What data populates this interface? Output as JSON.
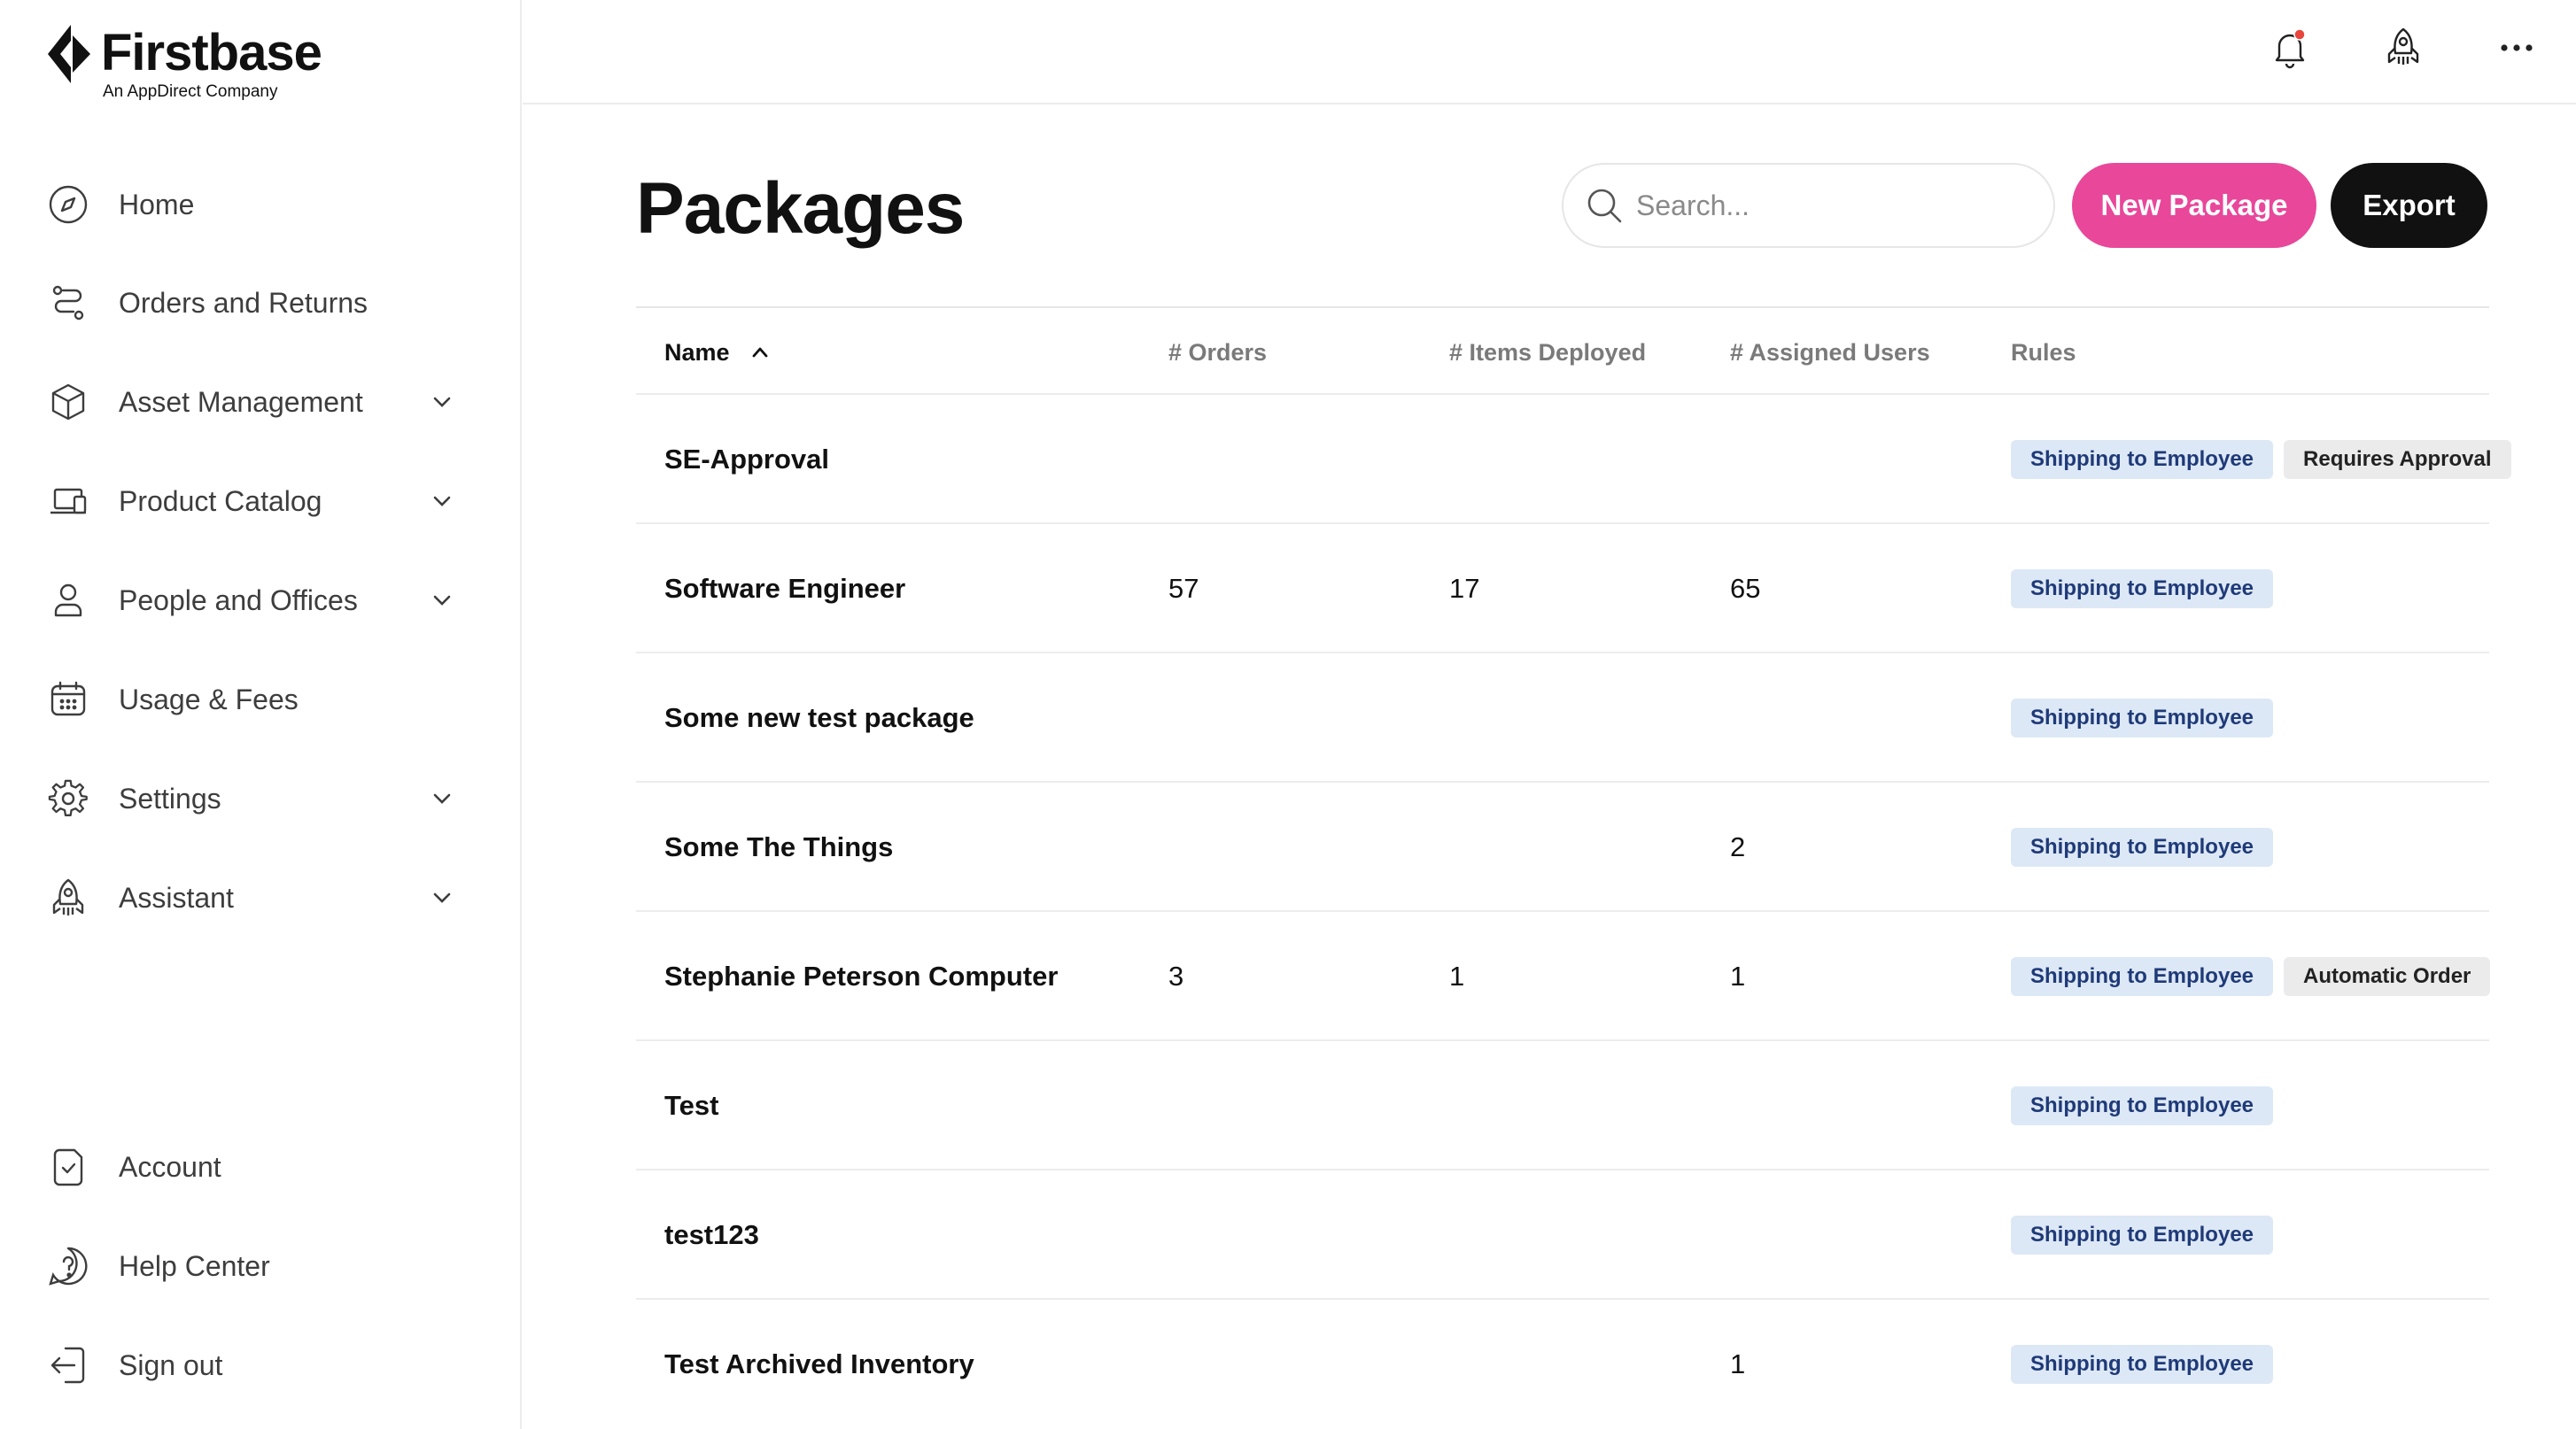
{
  "brand": {
    "name": "Firstbase",
    "tagline": "An AppDirect Company"
  },
  "sidebar": {
    "items": [
      {
        "label": "Home",
        "icon": "compass-icon",
        "expandable": false
      },
      {
        "label": "Orders and Returns",
        "icon": "route-icon",
        "expandable": false
      },
      {
        "label": "Asset Management",
        "icon": "box-icon",
        "expandable": true
      },
      {
        "label": "Product Catalog",
        "icon": "laptop-icon",
        "expandable": true
      },
      {
        "label": "People and Offices",
        "icon": "person-icon",
        "expandable": true
      },
      {
        "label": "Usage & Fees",
        "icon": "calendar-icon",
        "expandable": false
      },
      {
        "label": "Settings",
        "icon": "gear-icon",
        "expandable": true
      },
      {
        "label": "Assistant",
        "icon": "rocket-icon",
        "expandable": true
      }
    ],
    "bottom_items": [
      {
        "label": "Account",
        "icon": "account-icon"
      },
      {
        "label": "Help Center",
        "icon": "help-icon"
      },
      {
        "label": "Sign out",
        "icon": "sign-out-icon"
      }
    ]
  },
  "topbar": {
    "icons": [
      "bell-icon",
      "rocket-icon",
      "more-icon"
    ],
    "notification_color": "#e8453c"
  },
  "main": {
    "title": "Packages",
    "search_placeholder": "Search...",
    "new_package_label": "New Package",
    "export_label": "Export",
    "accent_color": "#e8479a"
  },
  "table": {
    "columns": {
      "name": "Name",
      "orders": "# Orders",
      "items": "# Items Deployed",
      "users": "# Assigned Users",
      "rules": "Rules"
    },
    "sort": "ascending",
    "rows": [
      {
        "name": "SE-Approval",
        "orders": "",
        "items": "",
        "users": "",
        "rules": [
          "Shipping to Employee",
          "Requires Approval"
        ]
      },
      {
        "name": "Software Engineer",
        "orders": "57",
        "items": "17",
        "users": "65",
        "rules": [
          "Shipping to Employee"
        ]
      },
      {
        "name": "Some new test package",
        "orders": "",
        "items": "",
        "users": "",
        "rules": [
          "Shipping to Employee"
        ]
      },
      {
        "name": "Some The Things",
        "orders": "",
        "items": "",
        "users": "2",
        "rules": [
          "Shipping to Employee"
        ]
      },
      {
        "name": "Stephanie Peterson Computer",
        "orders": "3",
        "items": "1",
        "users": "1",
        "rules": [
          "Shipping to Employee",
          "Automatic Order"
        ]
      },
      {
        "name": "Test",
        "orders": "",
        "items": "",
        "users": "",
        "rules": [
          "Shipping to Employee"
        ]
      },
      {
        "name": "test123",
        "orders": "",
        "items": "",
        "users": "",
        "rules": [
          "Shipping to Employee"
        ]
      },
      {
        "name": "Test Archived Inventory",
        "orders": "",
        "items": "",
        "users": "1",
        "rules": [
          "Shipping to Employee"
        ]
      }
    ]
  }
}
